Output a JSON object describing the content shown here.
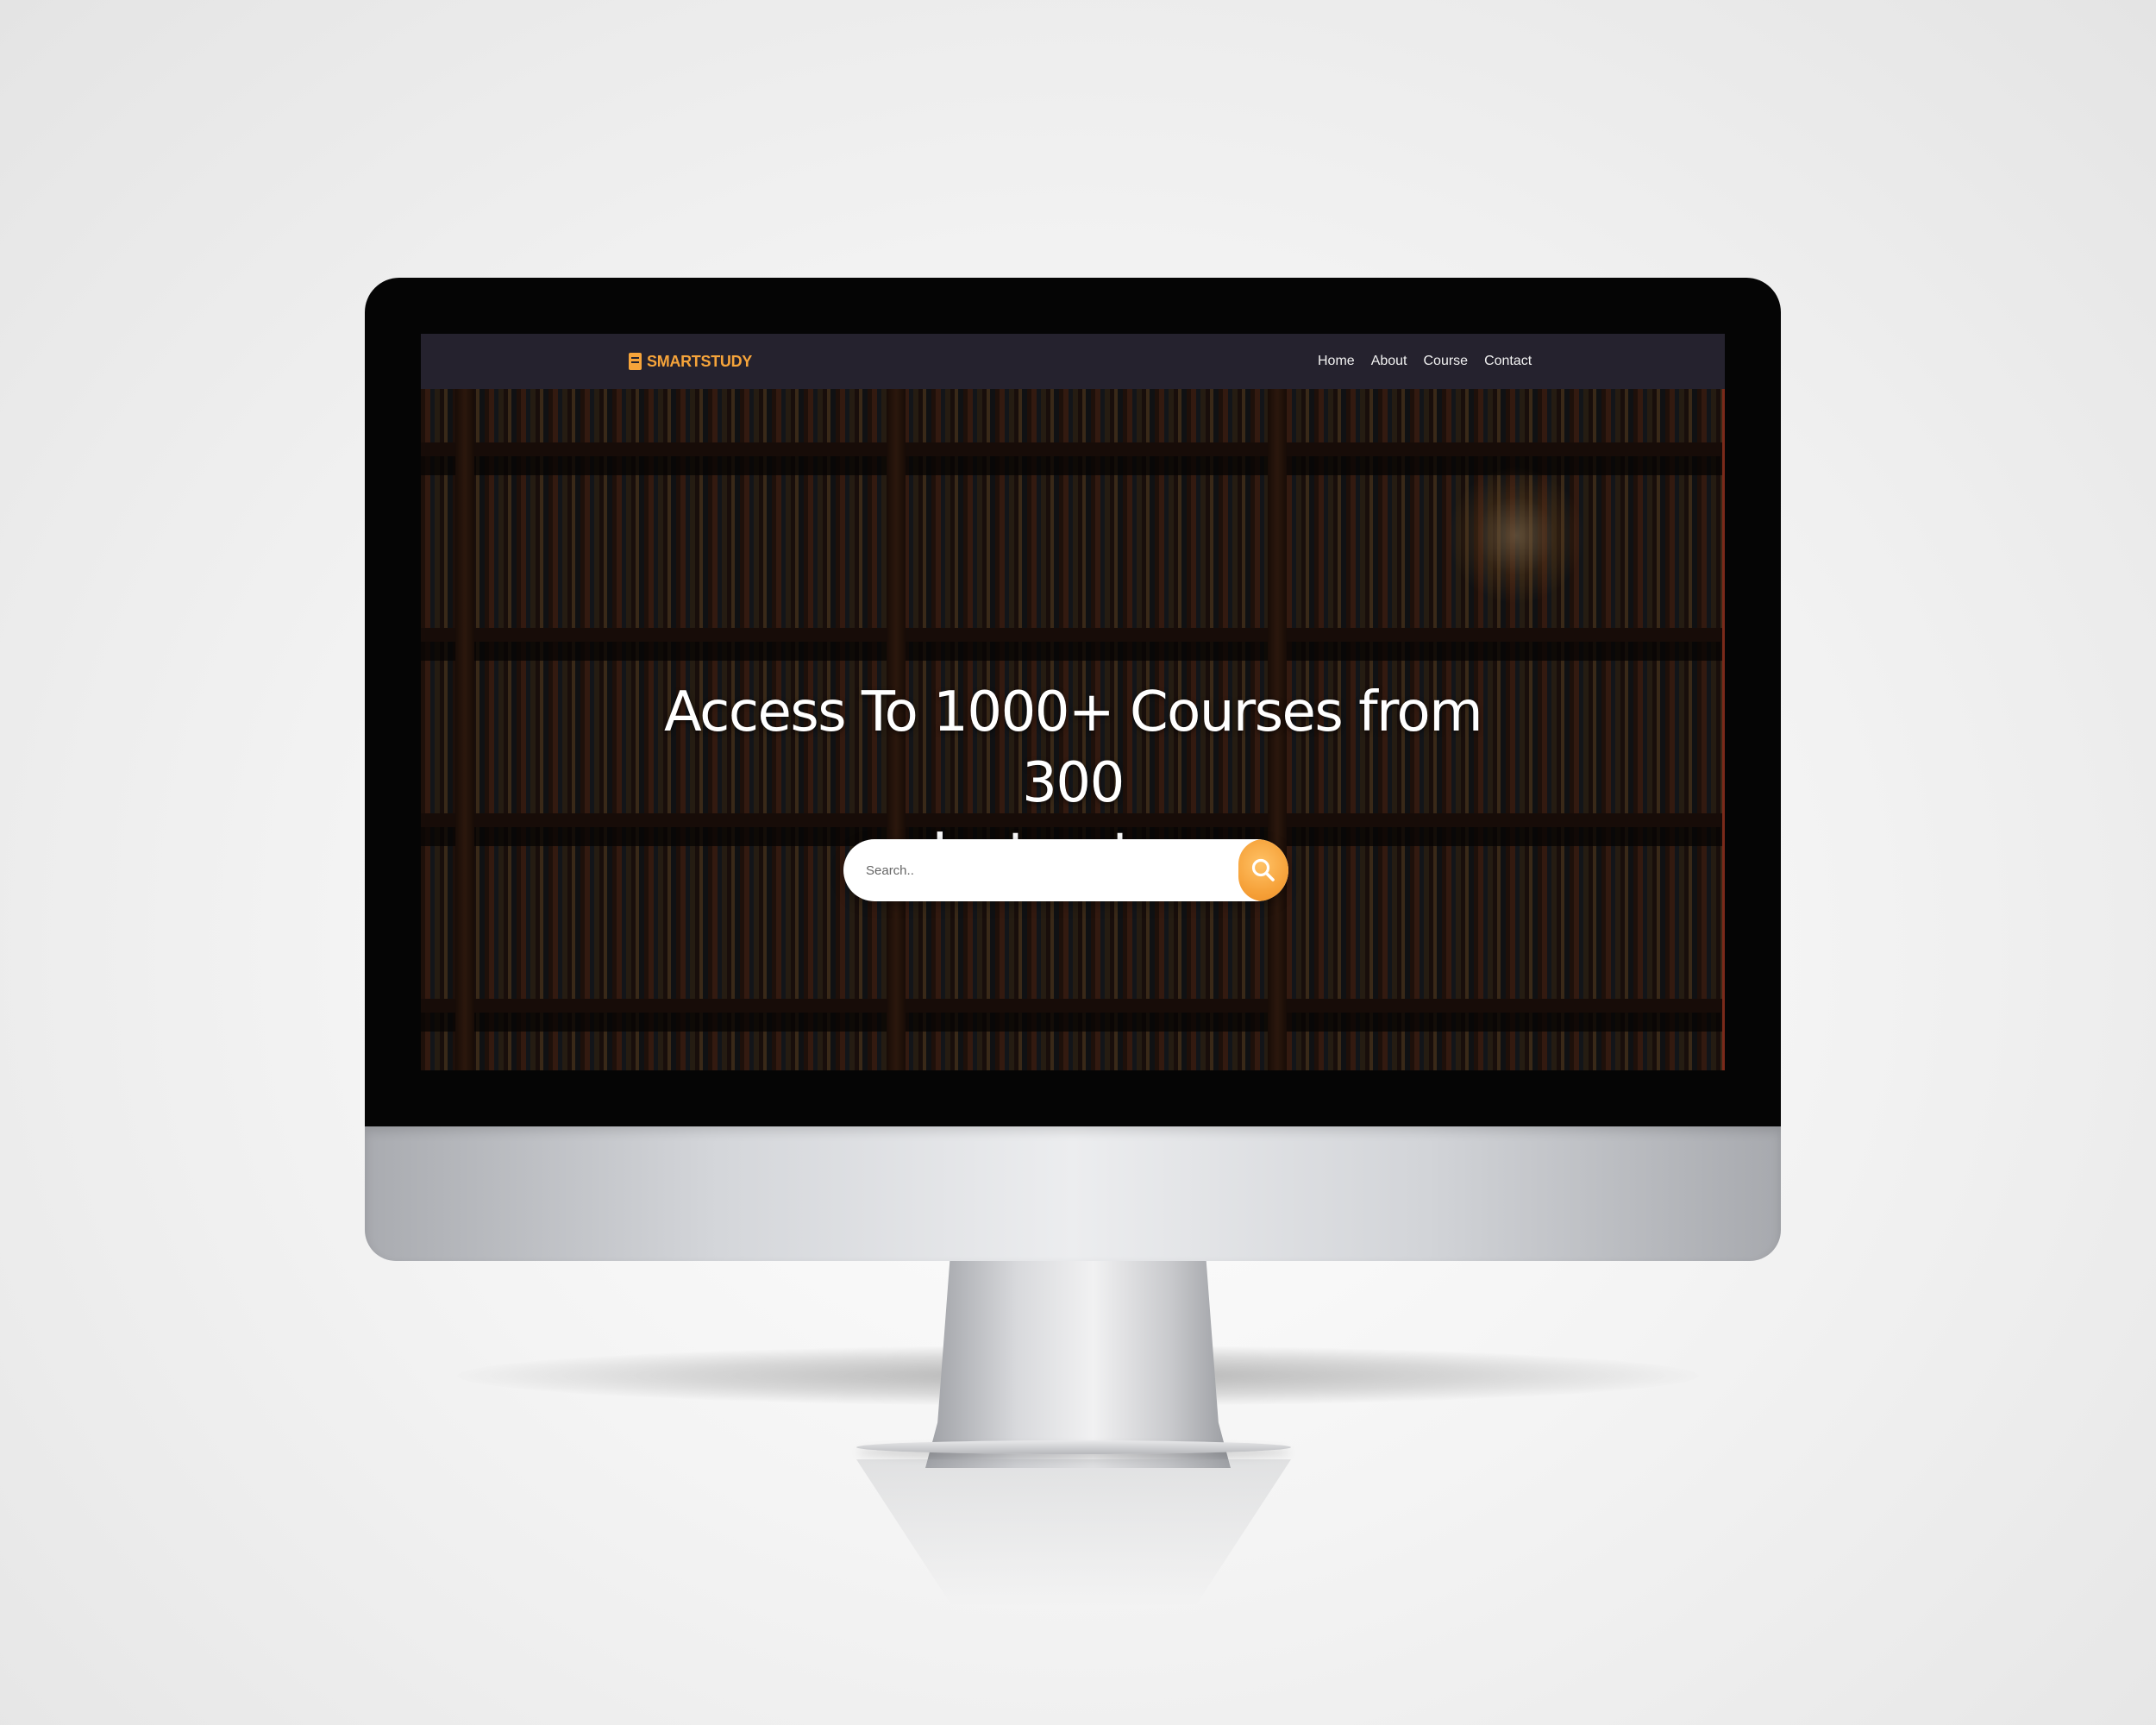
{
  "brand": {
    "name": "SMARTSTUDY",
    "color": "#f6a43a",
    "icon": "book-icon"
  },
  "nav": {
    "links": [
      "Home",
      "About",
      "Course",
      "Contact"
    ]
  },
  "hero": {
    "title_line1": "Access To 1000+ Courses from 300",
    "title_line2": "Instructors"
  },
  "search": {
    "placeholder": "Search..",
    "button_icon": "search-icon",
    "button_color": "#f6a23a"
  },
  "colors": {
    "navbar_bg": "#25222e",
    "accent": "#f6a43a"
  }
}
